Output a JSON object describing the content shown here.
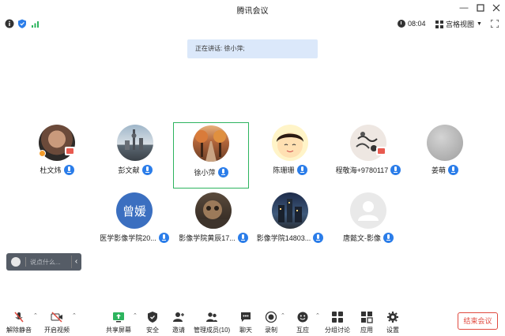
{
  "window": {
    "title": "腾讯会议"
  },
  "header": {
    "time": "08:04",
    "view_label": "宫格视图"
  },
  "speaking_banner": "正在讲话: 徐小萍;",
  "participants_row1": [
    {
      "name": "杜文炜"
    },
    {
      "name": "彭文献"
    },
    {
      "name": "徐小萍"
    },
    {
      "name": "陈珊珊"
    },
    {
      "name": "程敬海+9780117"
    },
    {
      "name": "姜萌"
    }
  ],
  "participants_row2": [
    {
      "name": "医学影像学院20...",
      "avatar_text": "曾媛"
    },
    {
      "name": "影像学院黄辰17..."
    },
    {
      "name": "影像学院14803..."
    },
    {
      "name": "唐懿文-影像"
    }
  ],
  "chat": {
    "placeholder": "说点什么..."
  },
  "toolbar": {
    "unmute": "解除静音",
    "start_video": "开启视频",
    "share_screen": "共享屏幕",
    "security": "安全",
    "invite": "邀请",
    "manage_members": "管理成员(10)",
    "chat": "聊天",
    "record": "录制",
    "interact": "互应",
    "breakout": "分组讨论",
    "apps": "应用",
    "settings": "设置",
    "end_meeting": "结束会议"
  },
  "colors": {
    "accent_blue": "#2b7de9",
    "active_border": "#2db45e",
    "end_red": "#e04a3f",
    "banner_bg": "#dbe8fa"
  }
}
